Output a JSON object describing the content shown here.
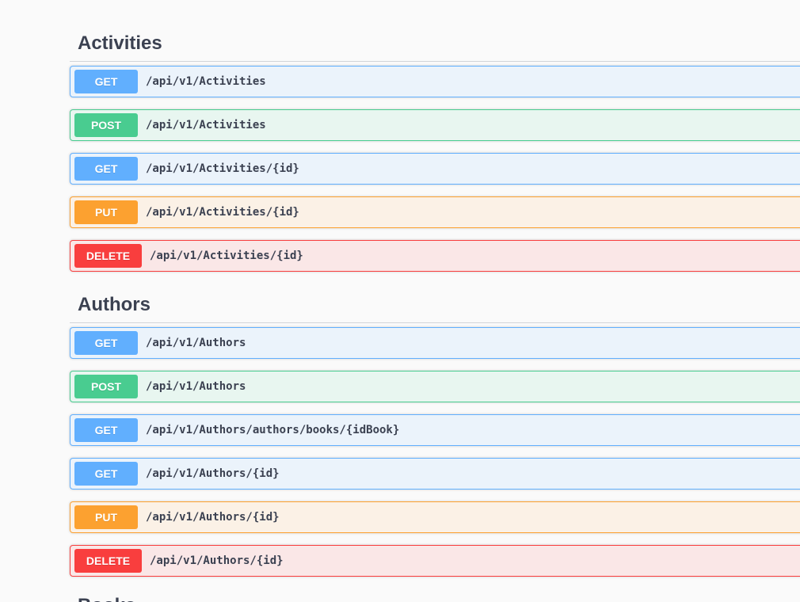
{
  "sections": [
    {
      "title": "Activities",
      "operations": [
        {
          "method": "GET",
          "path": "/api/v1/Activities"
        },
        {
          "method": "POST",
          "path": "/api/v1/Activities"
        },
        {
          "method": "GET",
          "path": "/api/v1/Activities/{id}"
        },
        {
          "method": "PUT",
          "path": "/api/v1/Activities/{id}"
        },
        {
          "method": "DELETE",
          "path": "/api/v1/Activities/{id}"
        }
      ]
    },
    {
      "title": "Authors",
      "operations": [
        {
          "method": "GET",
          "path": "/api/v1/Authors"
        },
        {
          "method": "POST",
          "path": "/api/v1/Authors"
        },
        {
          "method": "GET",
          "path": "/api/v1/Authors/authors/books/{idBook}"
        },
        {
          "method": "GET",
          "path": "/api/v1/Authors/{id}"
        },
        {
          "method": "PUT",
          "path": "/api/v1/Authors/{id}"
        },
        {
          "method": "DELETE",
          "path": "/api/v1/Authors/{id}"
        }
      ]
    },
    {
      "title": "Books",
      "operations": []
    }
  ],
  "colors": {
    "get": "#61affe",
    "post": "#49cc90",
    "put": "#fca130",
    "delete": "#f93e3e",
    "text": "#3b4151"
  }
}
